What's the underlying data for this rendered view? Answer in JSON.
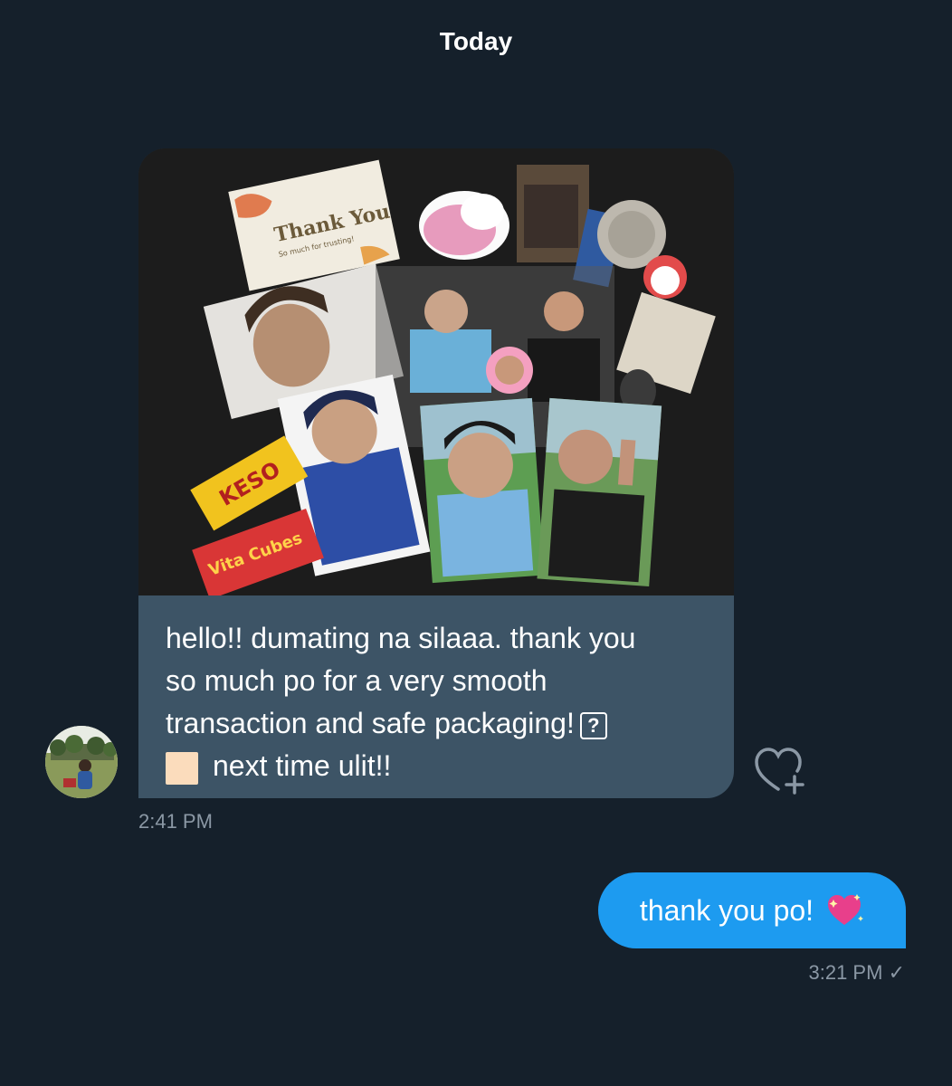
{
  "conversation": {
    "date_divider": "Today",
    "incoming": {
      "text_line1": "hello!! dumating na silaaa. thank you",
      "text_line2": "so much po for a very smooth",
      "text_line3": "transaction and safe packaging!",
      "unknown_glyph": "?",
      "text_line4": "next time ulit!!",
      "timestamp": "2:41 PM",
      "photo": {
        "thank_you_card_title": "Thank You",
        "thank_you_card_sub": "So much for trusting!",
        "snack1": "KESO",
        "snack2": "Vita Cubes"
      }
    },
    "outgoing": {
      "text": "thank you po!",
      "timestamp": "3:21 PM",
      "status": "✓"
    }
  },
  "colors": {
    "background": "#15202b",
    "incoming_bubble": "#3d5466",
    "outgoing_bubble": "#1d9bf0",
    "muted_text": "#8b98a5"
  }
}
